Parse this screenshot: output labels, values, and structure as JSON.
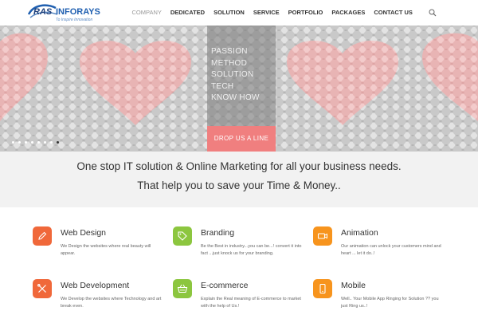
{
  "brand": {
    "name_prefix": "RAS",
    "name_suffix": "INFORAYS",
    "tagline": "To Inspire Innovation"
  },
  "nav": {
    "items": [
      {
        "label": "COMPANY",
        "active": true
      },
      {
        "label": "DEDICATED"
      },
      {
        "label": "SOLUTION"
      },
      {
        "label": "SERVICE"
      },
      {
        "label": "PORTFOLIO"
      },
      {
        "label": "PACKAGES"
      },
      {
        "label": "CONTACT US"
      }
    ],
    "search_icon": "search-icon"
  },
  "hero": {
    "words": [
      "PASSION",
      "METHOD",
      "SOLUTION",
      "TECH",
      "KNOW HOW"
    ],
    "cta": "DROP US A LINE",
    "slide_count": 8,
    "active_slide": 8,
    "colors": {
      "accent": "#f07f7f",
      "heart": "#f4a6a6"
    }
  },
  "tagline": {
    "line1": "One stop IT solution & Online Marketing for all your business needs.",
    "line2": "That help you to save your Time & Money.."
  },
  "services": [
    {
      "title": "Web Design",
      "desc": "We Design the websites where real beauty will appear.",
      "icon": "pencil-icon",
      "color": "#f0683a"
    },
    {
      "title": "Branding",
      "desc": "Be the Best in industry...you can be...! convert it into fact ...just knock us for your branding.",
      "icon": "tag-icon",
      "color": "#8cc63f"
    },
    {
      "title": "Animation",
      "desc": "Our animation can unlock your customers mind and heart ... let it do..!",
      "icon": "video-camera-icon",
      "color": "#f7941d"
    },
    {
      "title": "Web Development",
      "desc": "We Develop the websites where Technology and art break even.",
      "icon": "tools-icon",
      "color": "#f0683a"
    },
    {
      "title": "E-commerce",
      "desc": "Explain the Real meaning of E-commerce to market with the help of Us.!",
      "icon": "shopping-basket-icon",
      "color": "#8cc63f"
    },
    {
      "title": "Mobile",
      "desc": "Well.. Your Mobile App Ringing for Solution ?? you just Ring us..!",
      "icon": "mobile-icon",
      "color": "#f7941d"
    }
  ]
}
